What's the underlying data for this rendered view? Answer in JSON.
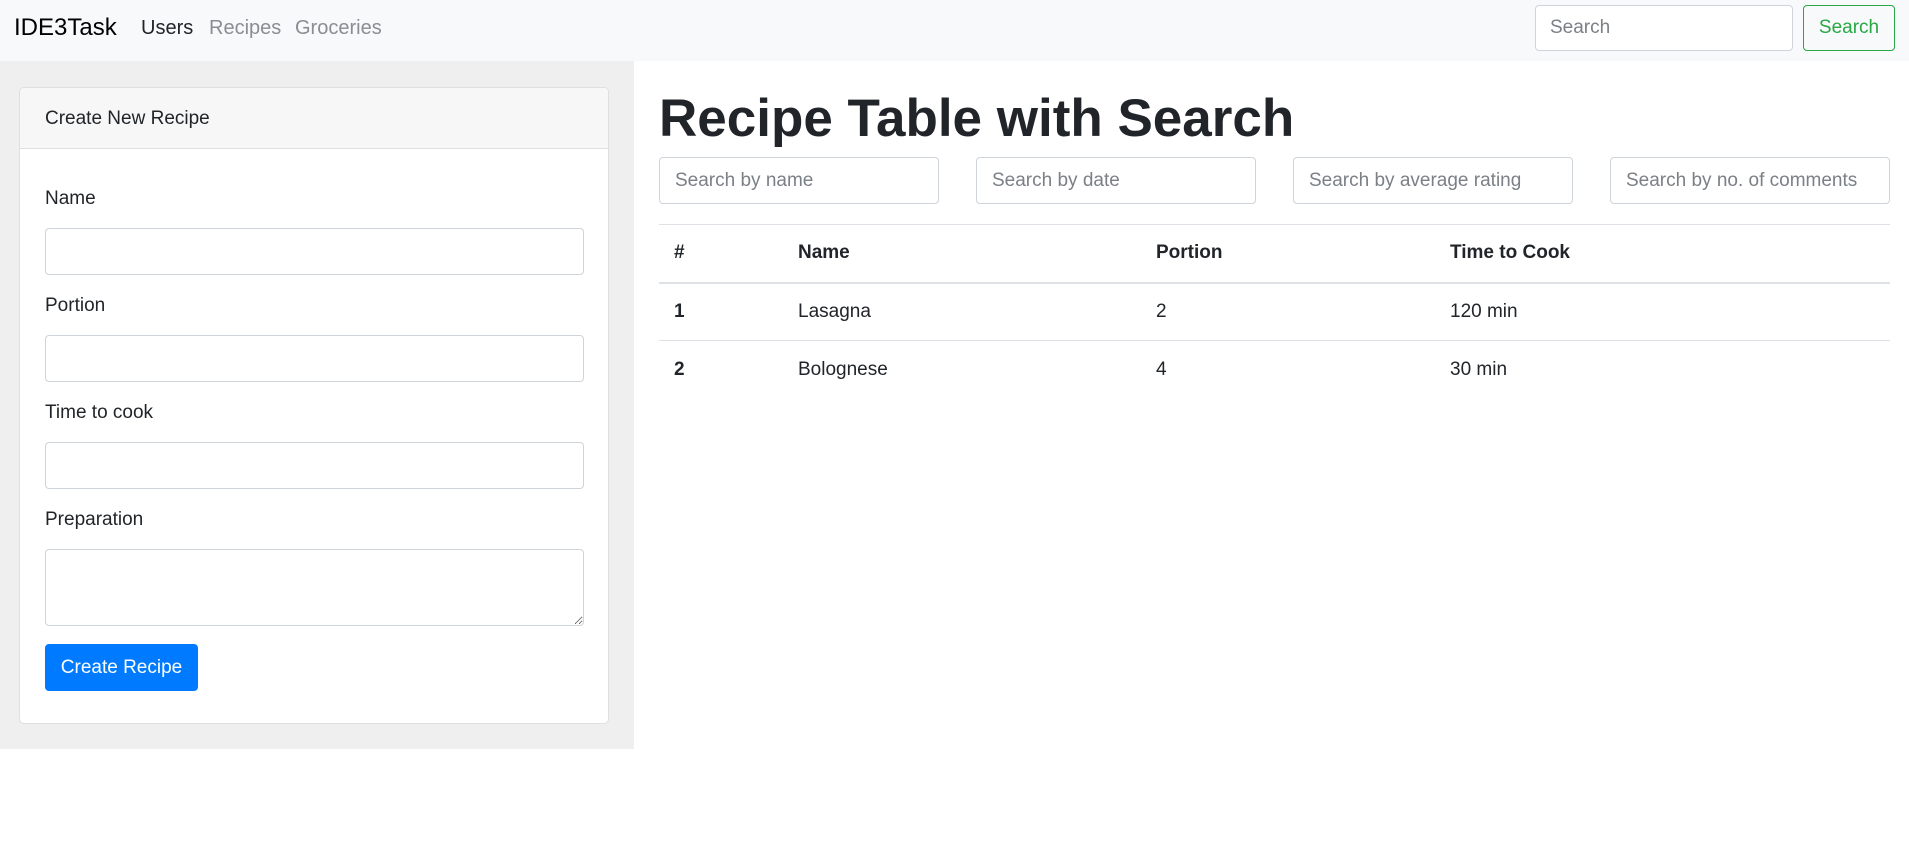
{
  "navbar": {
    "brand": "IDE3Task",
    "links": [
      {
        "label": "Users",
        "active": true
      },
      {
        "label": "Recipes",
        "active": false
      },
      {
        "label": "Groceries",
        "active": false
      }
    ],
    "search_placeholder": "Search",
    "search_button": "Search"
  },
  "form": {
    "title": "Create New Recipe",
    "fields": {
      "name_label": "Name",
      "portion_label": "Portion",
      "time_label": "Time to cook",
      "preparation_label": "Preparation"
    },
    "submit_label": "Create Recipe"
  },
  "main": {
    "title": "Recipe Table with Search",
    "filters": {
      "name": "Search by name",
      "date": "Search by date",
      "rating": "Search by average rating",
      "comments": "Search by no. of comments"
    },
    "table": {
      "headers": [
        "#",
        "Name",
        "Portion",
        "Time to Cook"
      ],
      "rows": [
        [
          "1",
          "Lasagna",
          "2",
          "120 min"
        ],
        [
          "2",
          "Bolognese",
          "4",
          "30 min"
        ]
      ]
    }
  },
  "colors": {
    "primary": "#007bff",
    "success": "#28a745",
    "navbar_bg": "#f8f9fa",
    "panel_bg": "#efefef"
  }
}
